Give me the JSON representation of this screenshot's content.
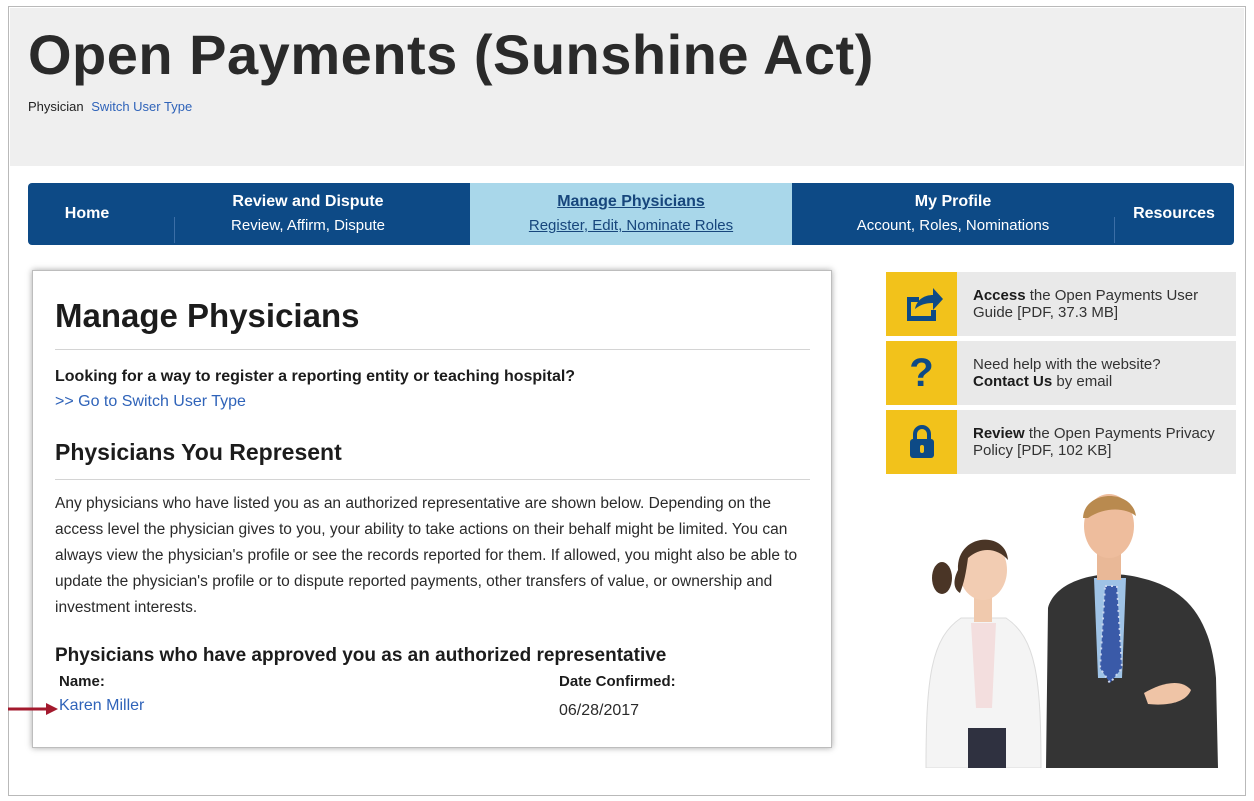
{
  "header": {
    "title": "Open Payments (Sunshine Act)",
    "user_type": "Physician",
    "switch_user_type": "Switch User Type"
  },
  "nav": {
    "items": [
      {
        "title": "Home",
        "subtitle": ""
      },
      {
        "title": "Review and Dispute",
        "subtitle": "Review, Affirm, Dispute"
      },
      {
        "title": "Manage Physicians",
        "subtitle": "Register, Edit, Nominate Roles",
        "active": true
      },
      {
        "title": "My Profile",
        "subtitle": "Account, Roles, Nominations"
      },
      {
        "title": "Resources",
        "subtitle": ""
      }
    ]
  },
  "main": {
    "title": "Manage Physicians",
    "question": "Looking for a way to register a reporting entity or teaching hospital?",
    "goto_link": ">> Go to Switch User Type",
    "section_title": "Physicians You Represent",
    "description": "Any physicians who have listed you as an authorized representative are shown below. Depending on the access level the physician gives to you, your ability to take actions on their behalf might be limited. You can always view the physician's profile or see the records reported for them. If allowed, you might also be able to update the physician's profile or to dispute reported payments, other transfers of value, or ownership and investment interests.",
    "approved_title": "Physicians who have approved you as an authorized representative",
    "columns": {
      "name": "Name:",
      "date": "Date Confirmed:"
    },
    "rows": [
      {
        "name": "Karen Miller",
        "date": "06/28/2017"
      }
    ]
  },
  "sidebar": {
    "items": [
      {
        "icon": "share-icon",
        "bold": "Access",
        "text": " the Open Payments User Guide [PDF, 37.3 MB]"
      },
      {
        "icon": "question-icon",
        "pre": "Need help with the website?",
        "bold": "Contact Us",
        "text": " by email"
      },
      {
        "icon": "lock-icon",
        "bold": "Review",
        "text": " the Open Payments Privacy Policy [PDF, 102 KB]"
      }
    ]
  },
  "colors": {
    "nav_bg": "#0d4a86",
    "nav_active": "#a9d7ea",
    "link": "#2f63b9",
    "icon_bg": "#f2c21b",
    "arrow": "#a3192d"
  }
}
